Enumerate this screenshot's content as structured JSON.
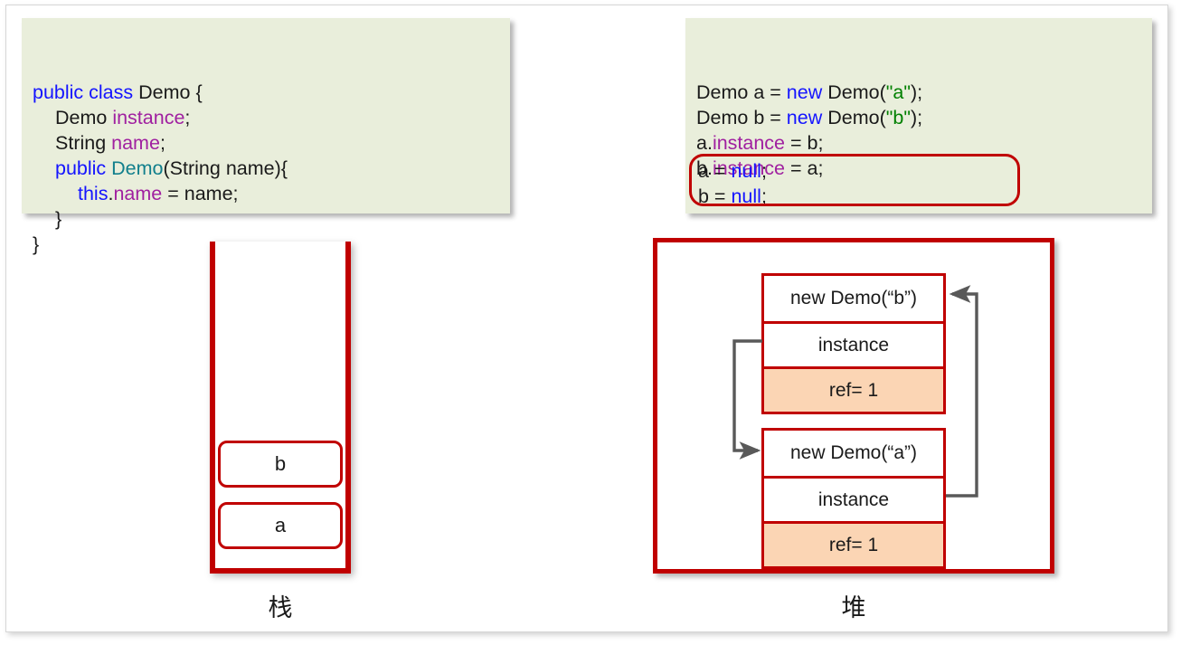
{
  "code_left": {
    "lines": [
      {
        "indent": 0,
        "tokens": [
          {
            "t": "public class",
            "c": "kw"
          },
          {
            "t": " Demo {",
            "c": "plain"
          }
        ]
      },
      {
        "indent": 1,
        "tokens": [
          {
            "t": "Demo ",
            "c": "plain"
          },
          {
            "t": "instance",
            "c": "field"
          },
          {
            "t": ";",
            "c": "plain"
          }
        ]
      },
      {
        "indent": 1,
        "tokens": [
          {
            "t": "String ",
            "c": "plain"
          },
          {
            "t": "name",
            "c": "field"
          },
          {
            "t": ";",
            "c": "plain"
          }
        ]
      },
      {
        "indent": 1,
        "tokens": [
          {
            "t": "public ",
            "c": "kw"
          },
          {
            "t": "Demo",
            "c": "type"
          },
          {
            "t": "(String name){",
            "c": "plain"
          }
        ]
      },
      {
        "indent": 2,
        "tokens": [
          {
            "t": "this",
            "c": "kw"
          },
          {
            "t": ".",
            "c": "plain"
          },
          {
            "t": "name",
            "c": "field"
          },
          {
            "t": " = name;",
            "c": "plain"
          }
        ]
      },
      {
        "indent": 1,
        "tokens": [
          {
            "t": "}",
            "c": "plain"
          }
        ]
      },
      {
        "indent": 0,
        "tokens": [
          {
            "t": "}",
            "c": "plain"
          }
        ]
      }
    ]
  },
  "code_right": {
    "lines": [
      {
        "indent": 0,
        "tokens": [
          {
            "t": "Demo a = ",
            "c": "plain"
          },
          {
            "t": "new",
            "c": "kw"
          },
          {
            "t": " Demo(",
            "c": "plain"
          },
          {
            "t": "\"a\"",
            "c": "str"
          },
          {
            "t": ");",
            "c": "plain"
          }
        ]
      },
      {
        "indent": 0,
        "tokens": [
          {
            "t": "Demo b = ",
            "c": "plain"
          },
          {
            "t": "new",
            "c": "kw"
          },
          {
            "t": " Demo(",
            "c": "plain"
          },
          {
            "t": "\"b\"",
            "c": "str"
          },
          {
            "t": ");",
            "c": "plain"
          }
        ]
      },
      {
        "indent": 0,
        "tokens": [
          {
            "t": "a.",
            "c": "plain"
          },
          {
            "t": "instance",
            "c": "field"
          },
          {
            "t": " = b;",
            "c": "plain"
          }
        ]
      },
      {
        "indent": 0,
        "tokens": [
          {
            "t": "b.",
            "c": "plain"
          },
          {
            "t": "instance",
            "c": "field"
          },
          {
            "t": " = a;",
            "c": "plain"
          }
        ]
      }
    ],
    "highlight_lines": [
      {
        "indent": 0,
        "tokens": [
          {
            "t": "a = ",
            "c": "plain"
          },
          {
            "t": "null",
            "c": "kw"
          },
          {
            "t": ";",
            "c": "plain"
          }
        ]
      },
      {
        "indent": 0,
        "tokens": [
          {
            "t": "b = ",
            "c": "plain"
          },
          {
            "t": "null",
            "c": "kw"
          },
          {
            "t": ";",
            "c": "plain"
          }
        ]
      }
    ]
  },
  "stack": {
    "label": "栈",
    "cells": [
      {
        "label": "b"
      },
      {
        "label": "a"
      }
    ]
  },
  "heap": {
    "label": "堆",
    "objects": [
      {
        "id": "b",
        "title": "new Demo(“b”)",
        "field": "instance",
        "refcount": "ref= 1"
      },
      {
        "id": "a",
        "title": "new Demo(“a”)",
        "field": "instance",
        "refcount": "ref= 1"
      }
    ]
  },
  "colors": {
    "red": "#c00000",
    "code_bg": "#e9eedb",
    "ref_bg": "#fbd5b4",
    "arrow": "#595959",
    "keyword": "#1414ff",
    "field": "#a020a0",
    "type": "#117f8c",
    "string": "#008000"
  }
}
